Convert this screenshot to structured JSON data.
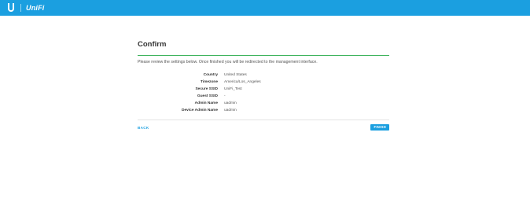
{
  "header": {
    "logo_text": "UniFi",
    "logo_mark_icon": "ubiquiti-u-icon",
    "accent_color": "#1b9fe0"
  },
  "confirm": {
    "title": "Confirm",
    "intro": "Please review the settings below. Once finished you will be redirected to the management interface.",
    "rows": [
      {
        "label": "Country",
        "value": "United States"
      },
      {
        "label": "Timezone",
        "value": "America/Los_Angeles"
      },
      {
        "label": "Secure SSID",
        "value": "UniFi_Test"
      },
      {
        "label": "Guest SSID",
        "value": "-"
      },
      {
        "label": "Admin Name",
        "value": "uadmin"
      },
      {
        "label": "Device Admin Name",
        "value": "uadmin"
      }
    ],
    "divider_color": "#3cb35b"
  },
  "actions": {
    "back_label": "BACK",
    "finish_label": "FINISH"
  }
}
